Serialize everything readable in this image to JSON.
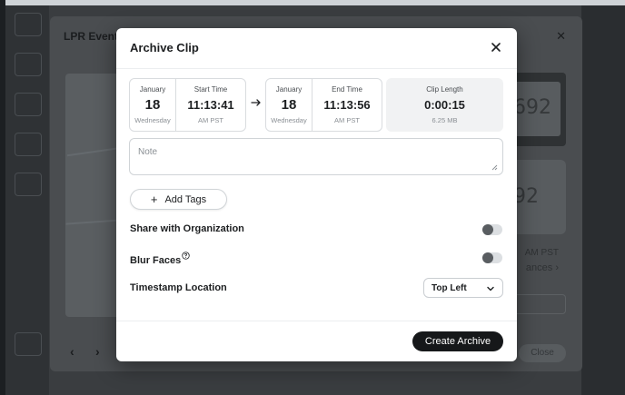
{
  "background": {
    "modal_title": "LPR Event",
    "plate_text_1": "692",
    "plate_text_2": "92",
    "time_text": "AM PST",
    "link_text": "ances",
    "close_label": "Close"
  },
  "dialog": {
    "title": "Archive Clip",
    "start": {
      "month": "January",
      "day": "18",
      "weekday": "Wednesday",
      "label": "Start Time",
      "time": "11:13:41",
      "tz": "AM PST"
    },
    "end": {
      "month": "January",
      "day": "18",
      "weekday": "Wednesday",
      "label": "End Time",
      "time": "11:13:56",
      "tz": "AM PST"
    },
    "clip": {
      "label": "Clip Length",
      "length": "0:00:15",
      "size": "6.25 MB"
    },
    "note_placeholder": "Note",
    "add_tags_label": "Add Tags",
    "share_label": "Share with Organization",
    "share_enabled": false,
    "blur_label": "Blur Faces",
    "blur_enabled": false,
    "timestamp_label": "Timestamp Location",
    "timestamp_value": "Top Left",
    "create_label": "Create Archive"
  },
  "icons": [
    "close-icon",
    "arrow-right-icon",
    "plus-icon",
    "help-icon",
    "chevron-down-icon",
    "resize-grip-icon"
  ],
  "colors": {
    "primary_button": "#16181a",
    "toggle_off_knob": "#595d61",
    "toggle_off_track": "#dcdfe2"
  }
}
